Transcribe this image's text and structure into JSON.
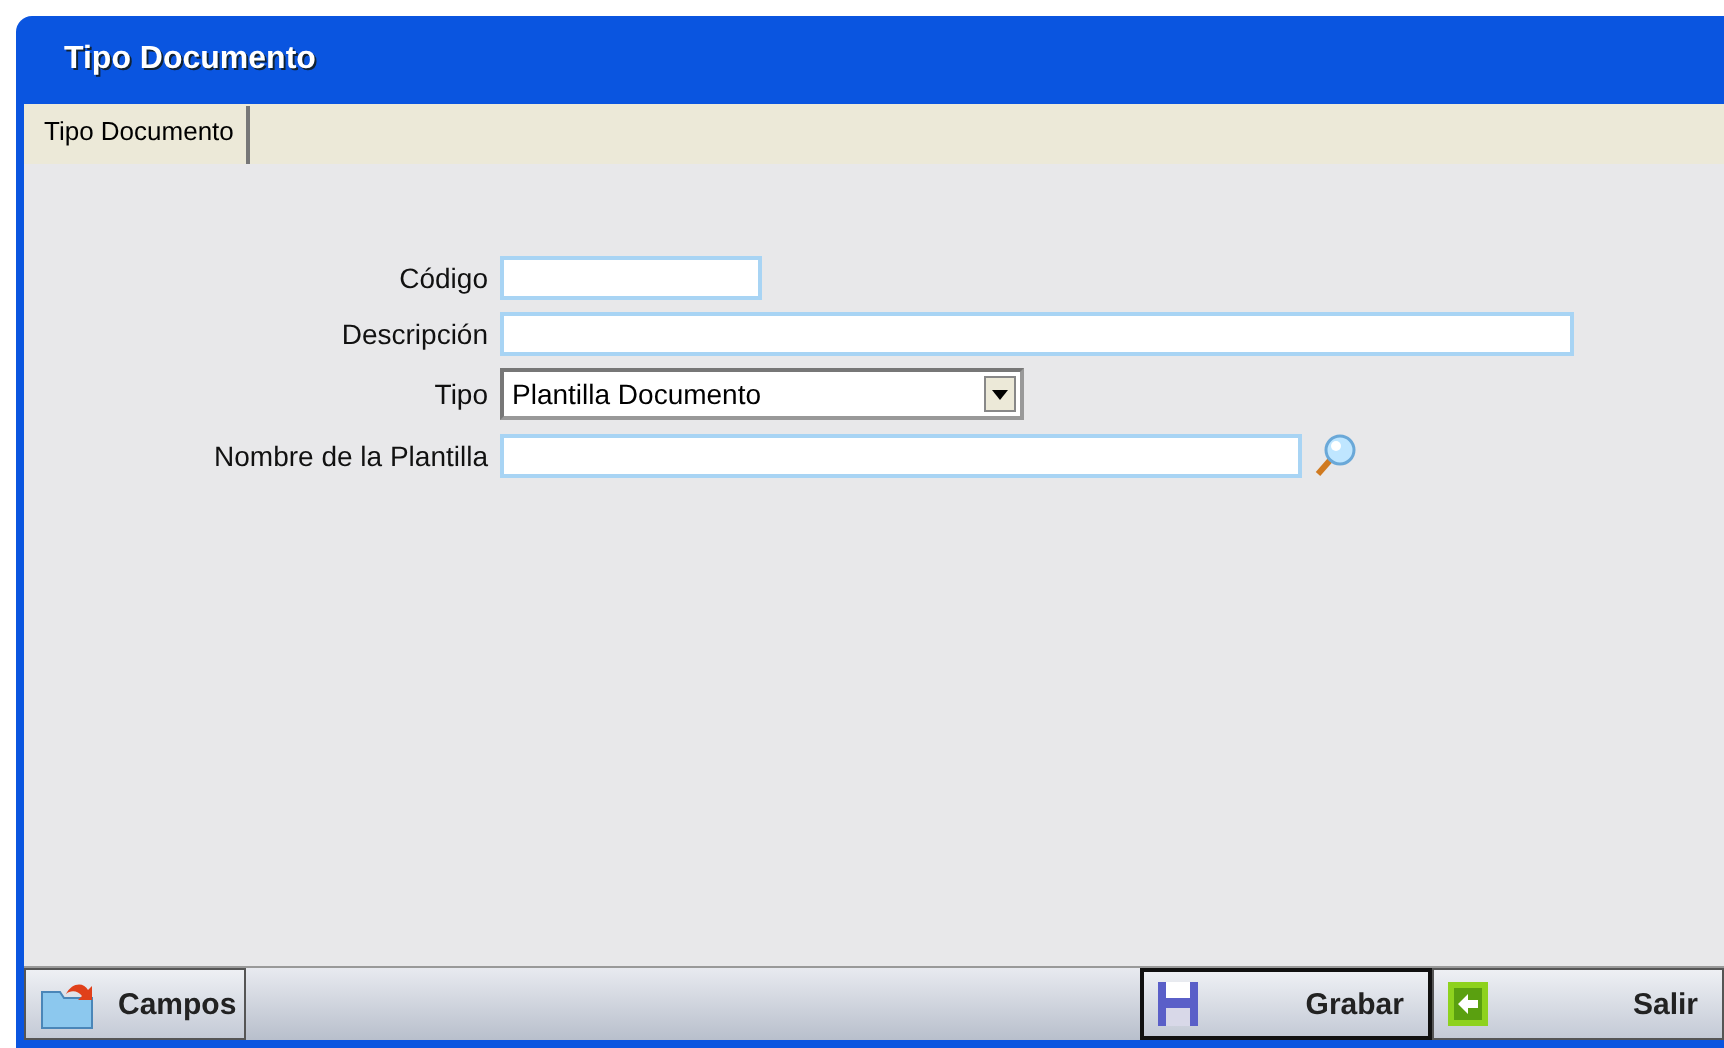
{
  "window": {
    "title": "Tipo Documento"
  },
  "tabs": [
    {
      "label": "Tipo Documento",
      "selected": true
    }
  ],
  "fields": [
    {
      "kind": "text",
      "label": "Código"
    },
    {
      "kind": "text",
      "label": "Descripción"
    },
    {
      "kind": "select",
      "label": "Tipo",
      "value": "Plantilla Documento"
    },
    {
      "kind": "lookup",
      "label": "Nombre de la Plantilla"
    }
  ],
  "toolbar": {
    "left": [
      {
        "label": "Campos",
        "kind": "folder"
      }
    ],
    "right": [
      {
        "label": "Grabar",
        "kind": "save"
      },
      {
        "label": "Salir",
        "kind": "exit"
      }
    ]
  }
}
